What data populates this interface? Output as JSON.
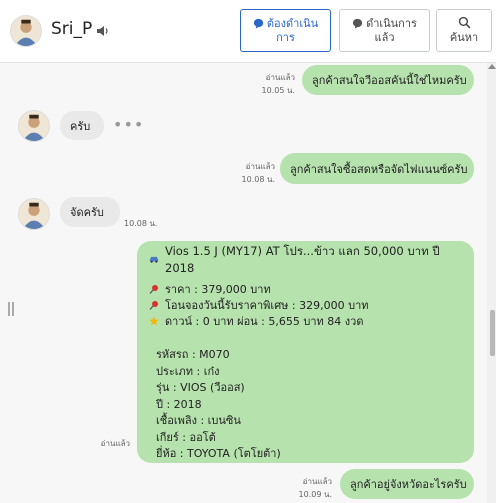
{
  "header": {
    "user_name": "Sri_P",
    "btn_todo_line1": "ต้องดำเนิน",
    "btn_todo_line2": "การ",
    "btn_doing_line1": "ดำเนินการ",
    "btn_doing_line2": "แล้ว",
    "btn_search": "ค้นหา"
  },
  "messages": {
    "m1": {
      "text": "ลูกค้าสนใจวีออสคันนี้ใช่ไหมครับ",
      "read": "อ่านแล้ว",
      "time": "10.05 น."
    },
    "m2": {
      "text": "ครับ"
    },
    "m3": {
      "text": "ลูกค้าสนใจซื้อสดหรือจัดไฟแนนซ์ครับ",
      "read": "อ่านแล้ว",
      "time": "10.08 น."
    },
    "m4": {
      "text": "จัดครับ",
      "time": "10.08 น."
    },
    "m6": {
      "text": "ลูกค้าอยู่จังหวัดอะไรครับ",
      "read": "อ่านแล้ว",
      "time": "10.09 น."
    }
  },
  "card": {
    "title": "Vios 1.5 J (MY17) AT โปร...ข้าว แลก 50,000 บาท ปี 2018",
    "price": "ราคา : 379,000 บาท",
    "promo": "โอนจองวันนี้รับราคาพิเศษ : 329,000 บาท",
    "down": "ดาวน์ : 0 บาท ผ่อน : 5,655 บาท 84 งวด",
    "specs": [
      "รหัสรถ : M070",
      "ประเภท : เก๋ง",
      "รุ่น : VIOS (วีออส)",
      "ปี : 2018",
      "เชื้อเพลิง : เบนซิน",
      "เกียร์ : ออโต้",
      "ยี่ห้อ : TOYOTA (โตโยต้า)"
    ],
    "read": "อ่านแล้ว"
  },
  "colors": {
    "outgoing_bubble": "#b6e2ad",
    "incoming_bubble": "#e9e9e9",
    "primary": "#2a66c7"
  },
  "icons": [
    "speaker-icon",
    "chat-bubble-icon",
    "search-icon",
    "car-icon",
    "pushpin-icon",
    "star-icon",
    "more-dots-icon"
  ]
}
